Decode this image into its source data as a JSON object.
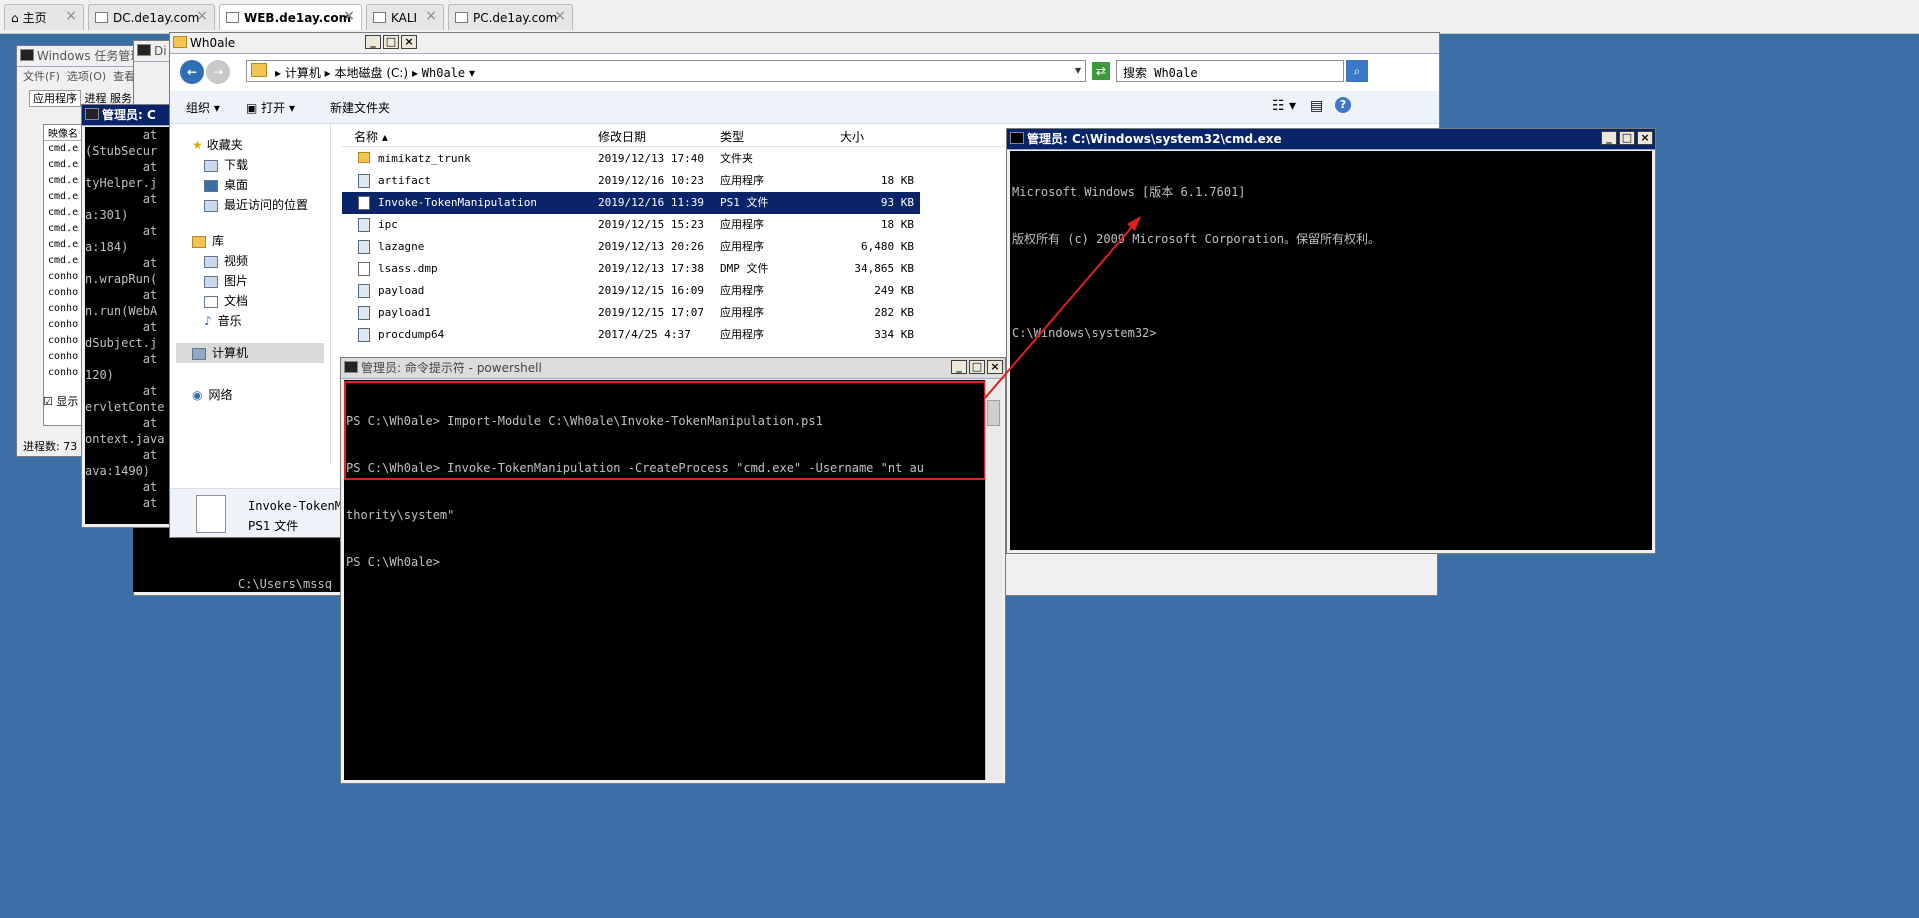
{
  "browser_tabs": [
    {
      "label": "主页",
      "icon": "home-icon",
      "active": false
    },
    {
      "label": "DC.de1ay.com",
      "icon": "vm-icon",
      "active": false
    },
    {
      "label": "WEB.de1ay.com",
      "icon": "vm-icon",
      "active": true
    },
    {
      "label": "KALI",
      "icon": "vm-icon",
      "active": false
    },
    {
      "label": "PC.de1ay.com",
      "icon": "vm-icon",
      "active": false
    }
  ],
  "task_manager": {
    "title": "Windows 任务管理器",
    "menu": [
      "文件(F)",
      "选项(O)",
      "查看(V"
    ],
    "tabs": [
      "应用程序",
      "进程",
      "服务"
    ],
    "column_header": "映像名",
    "processes": [
      "cmd.e",
      "cmd.e",
      "cmd.e",
      "cmd.e",
      "cmd.e",
      "cmd.e",
      "cmd.e",
      "cmd.e",
      "conho",
      "conho",
      "conho",
      "conho",
      "conho",
      "conho",
      "conho"
    ],
    "checkbox_label": "显示",
    "status": "进程数: 73"
  },
  "back_window": {
    "title_fragment": "Di"
  },
  "admin_cmd_back": {
    "title": "管理员: C",
    "lines": [
      "        at",
      "(StubSecur",
      "        at",
      "tyHelper.j",
      "        at",
      "a:301)",
      "        at",
      "a:184)",
      "        at",
      "n.wrapRun(",
      "        at",
      "n.run(WebA",
      "        at",
      "dSubject.j",
      "        at",
      "120)",
      "        at",
      "ervletConte",
      "        at",
      "ontext.java",
      "        at",
      "ava:1490)",
      "        at",
      "        at"
    ]
  },
  "back_console_line": "C:\\Users\\mssq",
  "explorer": {
    "title": "Wh0ale",
    "breadcrumb": [
      "计算机",
      "本地磁盘 (C:)",
      "Wh0ale"
    ],
    "search_placeholder": "搜索 Wh0ale",
    "toolbar": {
      "organize": "组织",
      "open": "打开",
      "new_folder": "新建文件夹"
    },
    "nav": {
      "favorites": "收藏夹",
      "downloads": "下载",
      "desktop": "桌面",
      "recent": "最近访问的位置",
      "library": "库",
      "videos": "视频",
      "pictures": "图片",
      "documents": "文档",
      "music": "音乐",
      "computer": "计算机",
      "network": "网络"
    },
    "columns": [
      "名称",
      "修改日期",
      "类型",
      "大小"
    ],
    "files": [
      {
        "name": "mimikatz_trunk",
        "date": "2019/12/13 17:40",
        "type": "文件夹",
        "size": "",
        "icon": "folder-icon",
        "selected": false
      },
      {
        "name": "artifact",
        "date": "2019/12/16 10:23",
        "type": "应用程序",
        "size": "18 KB",
        "icon": "app-icon",
        "selected": false
      },
      {
        "name": "Invoke-TokenManipulation",
        "date": "2019/12/16 11:39",
        "type": "PS1 文件",
        "size": "93 KB",
        "icon": "file-icon",
        "selected": true
      },
      {
        "name": "ipc",
        "date": "2019/12/15 15:23",
        "type": "应用程序",
        "size": "18 KB",
        "icon": "app-icon",
        "selected": false
      },
      {
        "name": "lazagne",
        "date": "2019/12/13 20:26",
        "type": "应用程序",
        "size": "6,480 KB",
        "icon": "app-icon",
        "selected": false
      },
      {
        "name": "lsass.dmp",
        "date": "2019/12/13 17:38",
        "type": "DMP 文件",
        "size": "34,865 KB",
        "icon": "file-icon",
        "selected": false
      },
      {
        "name": "payload",
        "date": "2019/12/15 16:09",
        "type": "应用程序",
        "size": "249 KB",
        "icon": "app-icon",
        "selected": false
      },
      {
        "name": "payload1",
        "date": "2019/12/15 17:07",
        "type": "应用程序",
        "size": "282 KB",
        "icon": "app-icon",
        "selected": false
      },
      {
        "name": "procdump64",
        "date": "2017/4/25 4:37",
        "type": "应用程序",
        "size": "334 KB",
        "icon": "app-icon",
        "selected": false
      }
    ],
    "details": {
      "name": "Invoke-TokenM",
      "type": "PS1 文件"
    }
  },
  "powershell": {
    "title": "管理员: 命令提示符 - powershell",
    "lines": [
      "PS C:\\Wh0ale> Import-Module C:\\Wh0ale\\Invoke-TokenManipulation.ps1",
      "PS C:\\Wh0ale> Invoke-TokenManipulation -CreateProcess \"cmd.exe\" -Username \"nt au",
      "thority\\system\"",
      "PS C:\\Wh0ale>"
    ],
    "highlight_color": "#e02020"
  },
  "system_cmd": {
    "title": "管理员: C:\\Windows\\system32\\cmd.exe",
    "lines": [
      "Microsoft Windows [版本 6.1.7601]",
      "版权所有 (c) 2009 Microsoft Corporation。保留所有权利。",
      "",
      "C:\\Windows\\system32>"
    ]
  },
  "colors": {
    "desktop": "#3a6ea5",
    "title_active": "#0a246a",
    "selection": "#0a246a",
    "arrow": "#e02020"
  }
}
